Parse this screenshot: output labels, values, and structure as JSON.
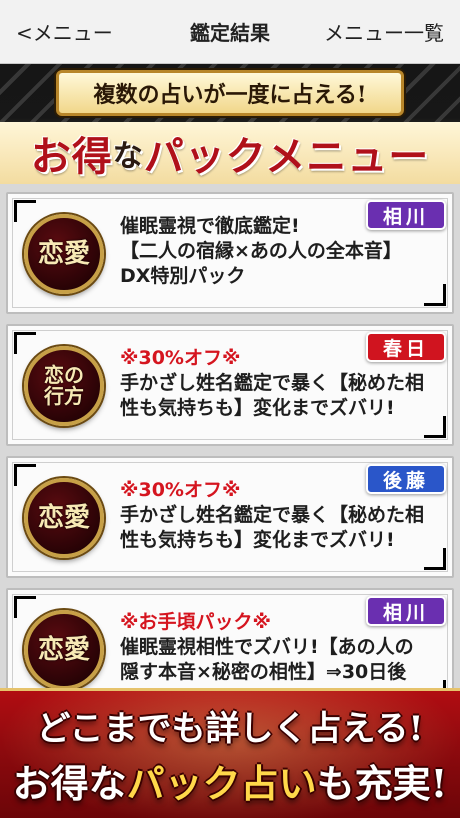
{
  "nav": {
    "back_label": "<メニュー",
    "title": "鑑定結果",
    "menu_label": "メニュー一覧"
  },
  "banner": {
    "top": "複数の占いが一度に占える!",
    "sub_1": "お得",
    "sub_2": "な",
    "sub_3": "パックメニュー"
  },
  "cards": [
    {
      "emblem_1": "恋愛",
      "emblem_2": "",
      "badge": "相川",
      "badge_color": "#6a2fb0",
      "promo": "",
      "line1": "催眠霊視で徹底鑑定!",
      "line2": "【二人の宿縁×あの人の全本音】",
      "line3": "DX特別パック"
    },
    {
      "emblem_1": "恋の",
      "emblem_2": "行方",
      "badge": "春日",
      "badge_color": "#d0141f",
      "promo": "※30%オフ※",
      "line1": "手かざし姓名鑑定で暴く【秘めた相",
      "line2": "性も気持ちも】変化までズバリ!",
      "line3": ""
    },
    {
      "emblem_1": "恋愛",
      "emblem_2": "",
      "badge": "後藤",
      "badge_color": "#2a56c9",
      "promo": "※30%オフ※",
      "line1": "手かざし姓名鑑定で暴く【秘めた相",
      "line2": "性も気持ちも】変化までズバリ!",
      "line3": ""
    },
    {
      "emblem_1": "恋愛",
      "emblem_2": "",
      "badge": "相川",
      "badge_color": "#6a2fb0",
      "promo": "※お手頃パック※",
      "line1": "催眠霊視相性でズバリ!【あの人の",
      "line2": "隠す本音×秘密の相性】⇒30日後",
      "line3": ""
    }
  ],
  "bottom": {
    "line1": "どこまでも詳しく占える!",
    "line2_a": "お得な",
    "line2_b": "パック占い",
    "line2_c": "も充実!"
  }
}
